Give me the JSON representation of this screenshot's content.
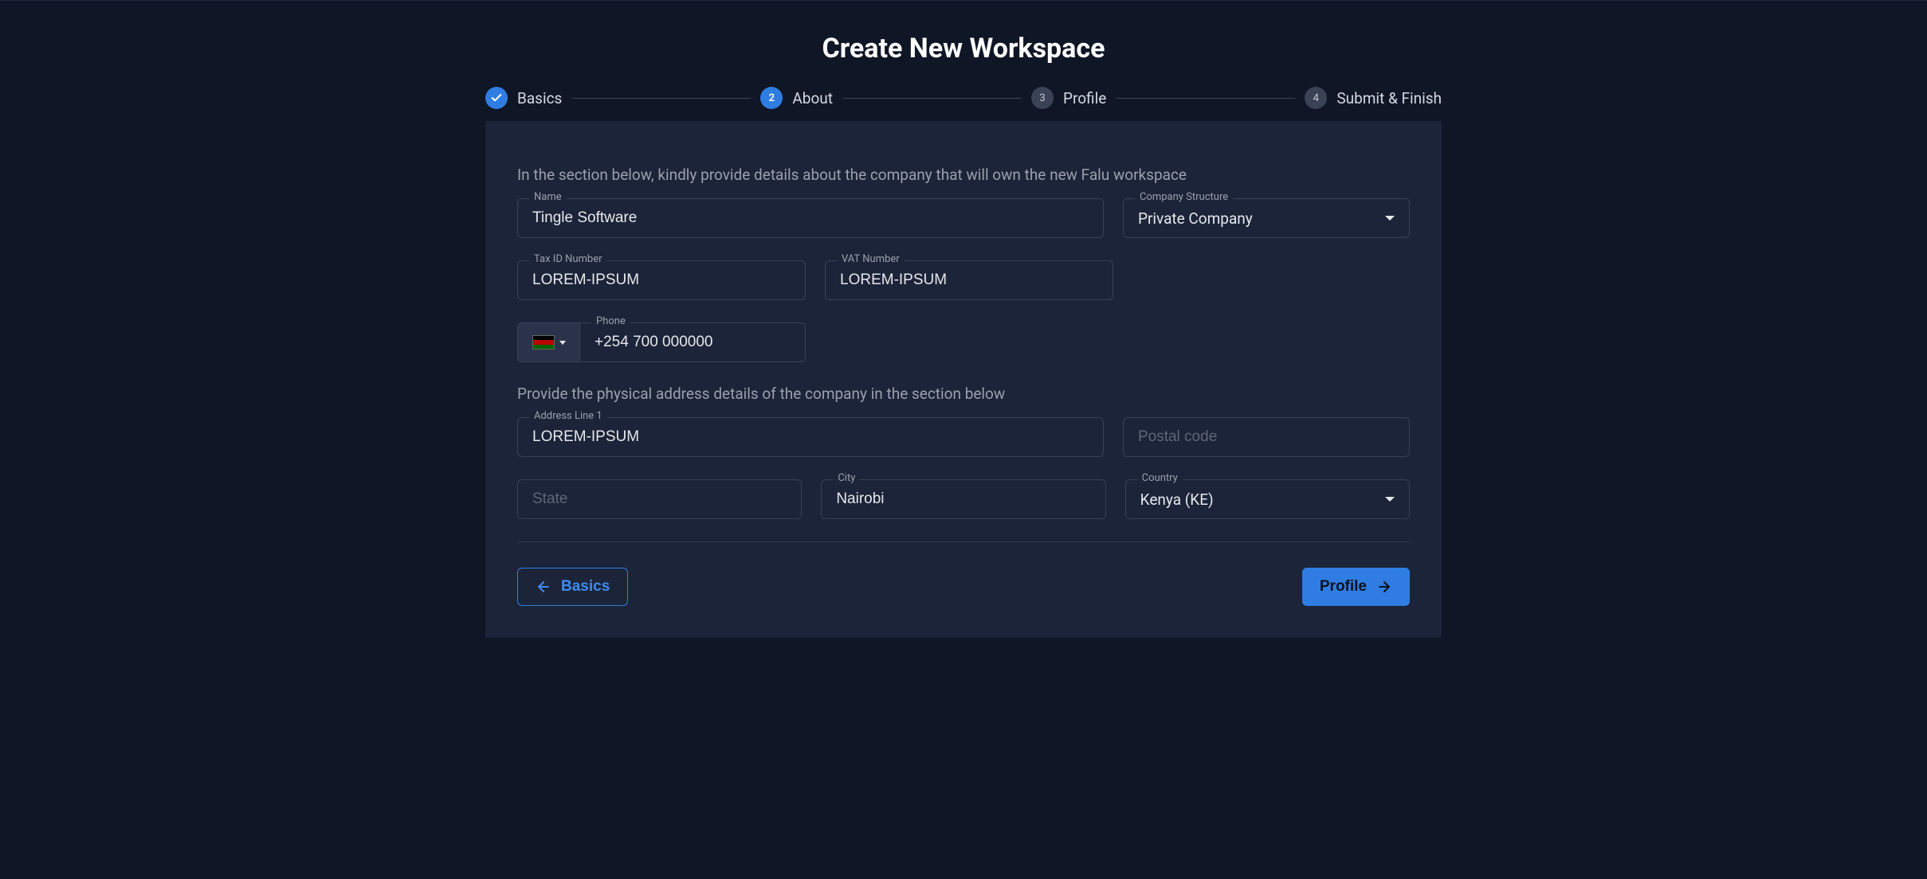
{
  "title": "Create New Workspace",
  "steps": {
    "s1": {
      "label": "Basics"
    },
    "s2": {
      "num": "2",
      "label": "About"
    },
    "s3": {
      "num": "3",
      "label": "Profile"
    },
    "s4": {
      "num": "4",
      "label": "Submit & Finish"
    }
  },
  "section1_text": "In the section below, kindly provide details about the company that will own the new Falu workspace",
  "section2_text": "Provide the physical address details of the company in the section below",
  "fields": {
    "name": {
      "label": "Name",
      "value": "Tingle Software"
    },
    "structure": {
      "label": "Company Structure",
      "value": "Private Company"
    },
    "tax": {
      "label": "Tax ID Number",
      "value": "LOREM-IPSUM"
    },
    "vat": {
      "label": "VAT Number",
      "value": "LOREM-IPSUM"
    },
    "phone": {
      "label": "Phone",
      "value": "+254 700 000000",
      "country_icon": "kenya-flag"
    },
    "addr1": {
      "label": "Address Line 1",
      "value": "LOREM-IPSUM"
    },
    "postal": {
      "placeholder": "Postal code",
      "value": ""
    },
    "state": {
      "placeholder": "State",
      "value": ""
    },
    "city": {
      "label": "City",
      "value": "Nairobi"
    },
    "country": {
      "label": "Country",
      "value": "Kenya (KE)"
    }
  },
  "buttons": {
    "back": "Basics",
    "next": "Profile"
  },
  "colors": {
    "accent": "#2f7de2",
    "card_bg": "#1b2438",
    "page_bg": "#0f1626"
  }
}
